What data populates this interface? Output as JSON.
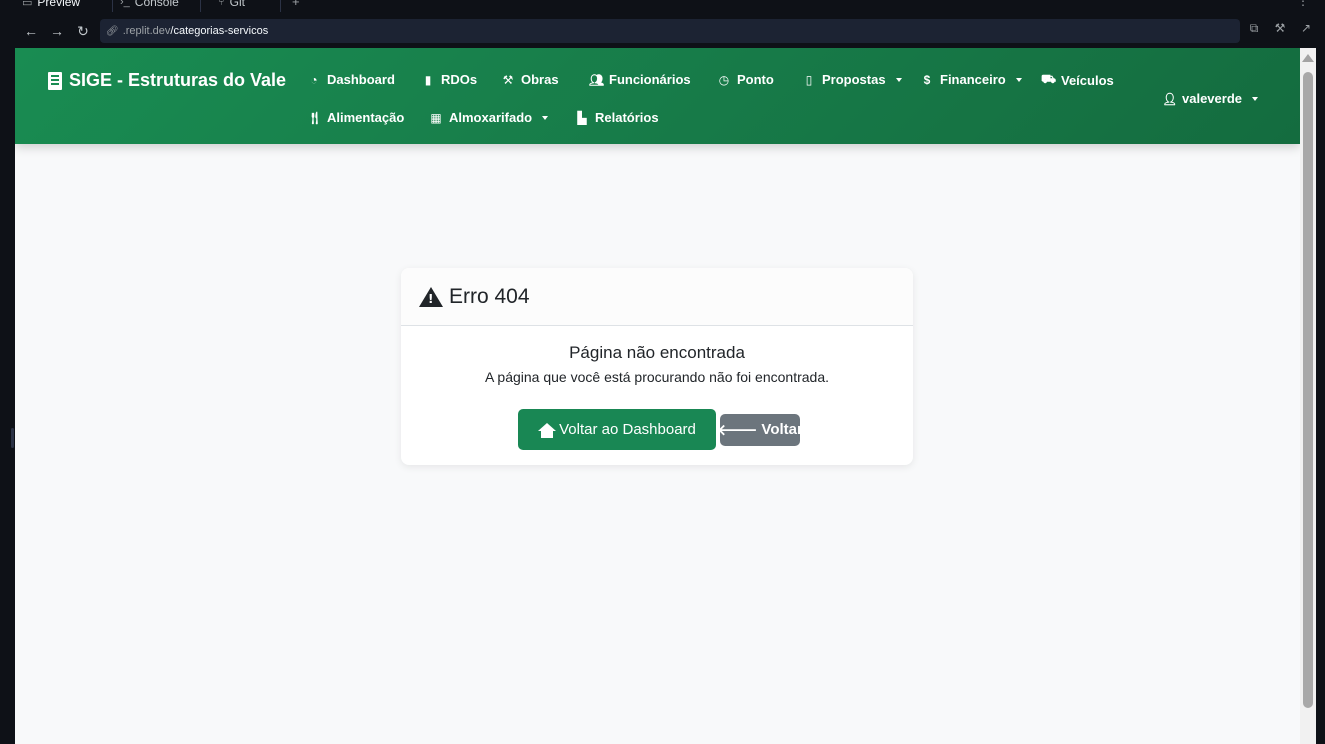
{
  "browser": {
    "tabs": [
      {
        "label": "Preview",
        "icon": "preview-icon"
      },
      {
        "label": "Console",
        "icon": "terminal-icon"
      },
      {
        "label": "Git",
        "icon": "git-icon"
      }
    ],
    "url_prefix": ".replit.dev",
    "url_path": "/categorias-servicos"
  },
  "navbar": {
    "brand": "SIGE - Estruturas do Vale",
    "items": [
      {
        "label": "Dashboard",
        "icon": "gauge-icon",
        "dropdown": false
      },
      {
        "label": "RDOs",
        "icon": "file-icon",
        "dropdown": false
      },
      {
        "label": "Obras",
        "icon": "hammer-icon",
        "dropdown": false
      },
      {
        "label": "Funcionários",
        "icon": "users-icon",
        "dropdown": false
      },
      {
        "label": "Ponto",
        "icon": "clock-icon",
        "dropdown": false
      },
      {
        "label": "Propostas",
        "icon": "document-icon",
        "dropdown": true
      },
      {
        "label": "Financeiro",
        "icon": "dollar-icon",
        "dropdown": true
      },
      {
        "label": "Veículos",
        "icon": "car-icon",
        "dropdown": false
      },
      {
        "label": "Alimentação",
        "icon": "utensils-icon",
        "dropdown": false
      },
      {
        "label": "Almoxarifado",
        "icon": "boxes-icon",
        "dropdown": true
      },
      {
        "label": "Relatórios",
        "icon": "chart-icon",
        "dropdown": false
      }
    ],
    "user": {
      "label": "valeverde",
      "icon": "user-icon"
    }
  },
  "error_card": {
    "title": "Erro 404",
    "subtitle": "Página não encontrada",
    "message": "A página que você está procurando não foi encontrada.",
    "primary_button": "Voltar ao Dashboard",
    "secondary_button": "Voltar"
  },
  "colors": {
    "navbar": "#198754",
    "primary_button": "#198754",
    "secondary_button": "#6c757d",
    "page_background": "#f8f9fa"
  }
}
